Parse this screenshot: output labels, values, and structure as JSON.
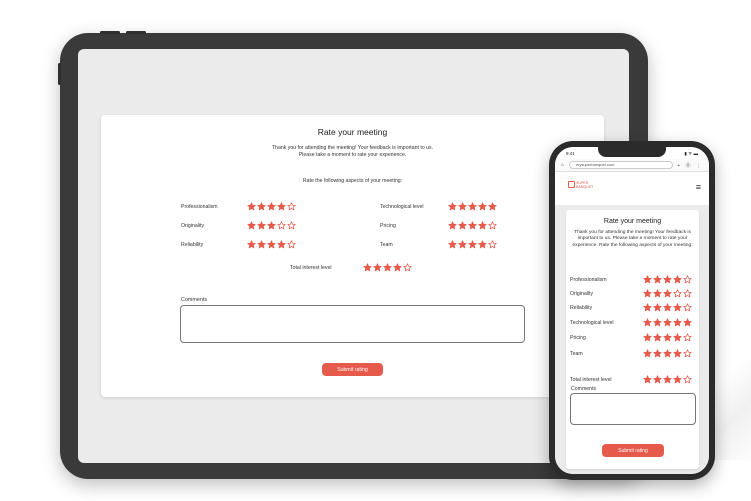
{
  "form": {
    "title": "Rate your meeting",
    "intro_tablet_line1": "Thank you for attending the meeting! Your feedback is important to us.",
    "intro_tablet_line2": "Please take a moment to rate your experience.",
    "prompt": "Rate the following aspects of your meeting:",
    "intro_phone": "Thank you for attending the meeting! Your feedback is important to us. Please take a moment to rate your experience. Rate the following aspects of your meeting:",
    "comments_label": "Comments",
    "submit_label": "Submit rating",
    "max_stars": 5,
    "accent_color": "#e55a4a"
  },
  "ratings": [
    {
      "label": "Professionalism",
      "stars": 4
    },
    {
      "label": "Originality",
      "stars": 3
    },
    {
      "label": "Reliability",
      "stars": 4
    },
    {
      "label": "Technological level",
      "stars": 5
    },
    {
      "label": "Pricing",
      "stars": 4
    },
    {
      "label": "Team",
      "stars": 4
    }
  ],
  "total": {
    "label": "Total interest level",
    "stars": 4
  },
  "phone": {
    "time": "9:41",
    "signal": "▮ ᯤ ▬",
    "url": "mysuperbanquet.com",
    "url_icons": "+ ⓪ ⋮",
    "home_icon": "⌂",
    "logo_text": "SUPER BANQUET"
  }
}
